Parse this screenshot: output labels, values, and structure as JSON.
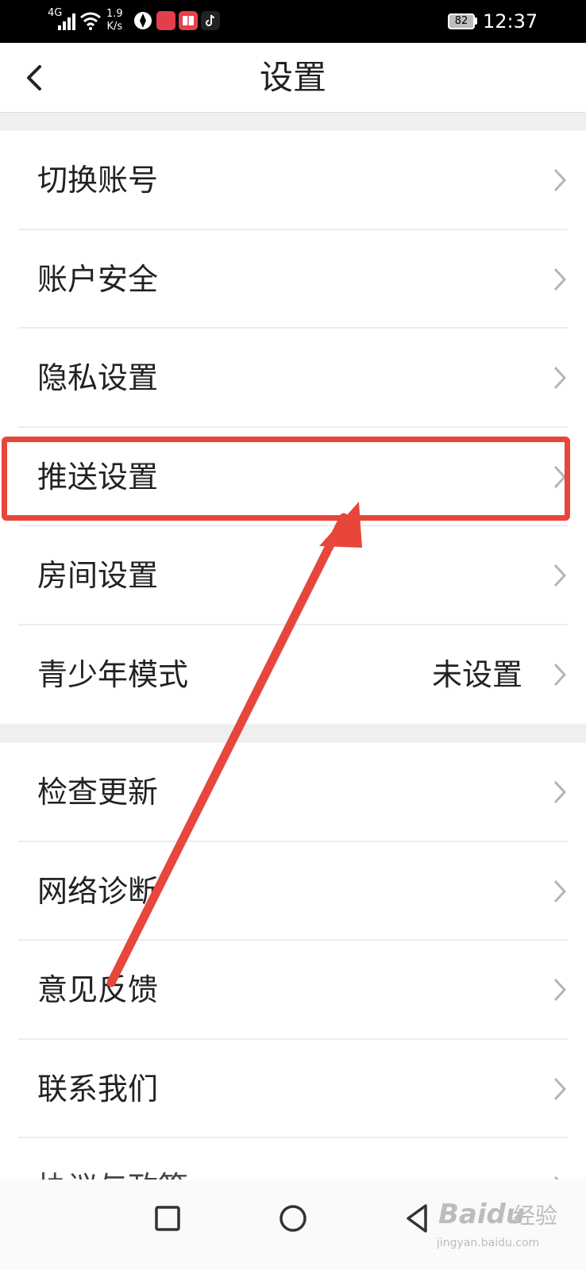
{
  "status_bar": {
    "network": "4G",
    "speed_value": "1.9",
    "speed_unit": "K/s",
    "battery": "82",
    "time": "12:37",
    "icons": [
      "signal-icon",
      "wifi-icon",
      "app-icon-1",
      "huawei-app-icon",
      "reader-app-icon",
      "tiktok-app-icon"
    ]
  },
  "header": {
    "title": "设置",
    "back_icon": "back-chevron-icon"
  },
  "group1": [
    {
      "label": "切换账号"
    },
    {
      "label": "账户安全"
    },
    {
      "label": "隐私设置"
    },
    {
      "label": "推送设置",
      "highlighted": true
    },
    {
      "label": "房间设置"
    },
    {
      "label": "青少年模式",
      "value": "未设置"
    }
  ],
  "group2": [
    {
      "label": "检查更新"
    },
    {
      "label": "网络诊断"
    },
    {
      "label": "意见反馈"
    },
    {
      "label": "联系我们"
    },
    {
      "label": "协议与政策"
    }
  ],
  "navbar": {
    "buttons": [
      "recent-apps-icon",
      "home-icon",
      "back-triangle-icon"
    ]
  },
  "watermark": {
    "brand": "Baidu",
    "cn": "经验",
    "url": "jingyan.baidu.com"
  },
  "colors": {
    "annotation": "#e8463a",
    "text": "#222222",
    "divider": "#ececec",
    "background": "#efefef"
  }
}
